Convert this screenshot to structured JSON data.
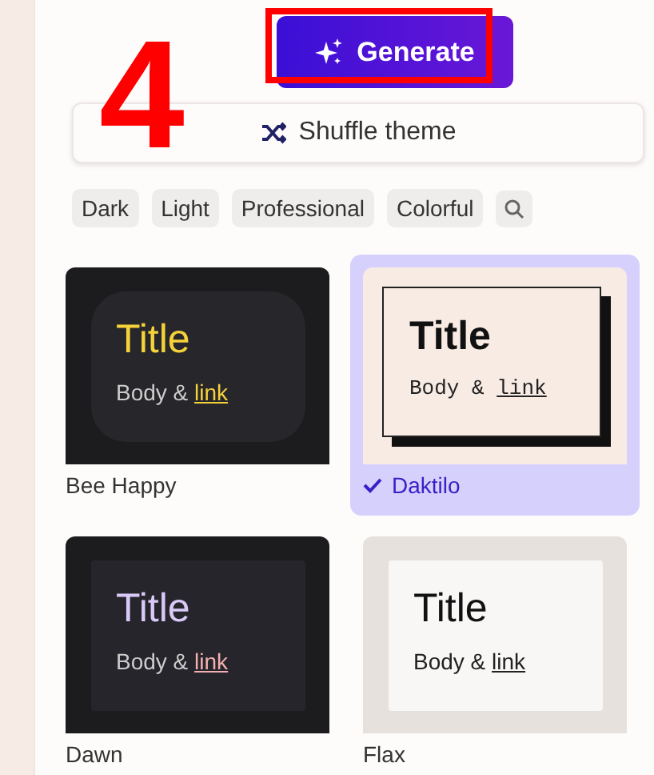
{
  "annotation": {
    "label": "4"
  },
  "generate_button": {
    "label": "Generate",
    "highlighted": true
  },
  "shuffle_button": {
    "label": "Shuffle theme"
  },
  "filters": [
    {
      "label": "Dark"
    },
    {
      "label": "Light"
    },
    {
      "label": "Professional"
    },
    {
      "label": "Colorful"
    }
  ],
  "themes": [
    {
      "name": "Bee Happy",
      "kind": "bee",
      "selected": false,
      "title": "Title",
      "body": "Body &",
      "link": "link"
    },
    {
      "name": "Daktilo",
      "kind": "daktilo",
      "selected": true,
      "title": "Title",
      "body": "Body &",
      "link": "link"
    },
    {
      "name": "Dawn",
      "kind": "dawn",
      "selected": false,
      "title": "Title",
      "body": "Body &",
      "link": "link"
    },
    {
      "name": "Flax",
      "kind": "flax",
      "selected": false,
      "title": "Title",
      "body": "Body &",
      "link": "link"
    }
  ]
}
